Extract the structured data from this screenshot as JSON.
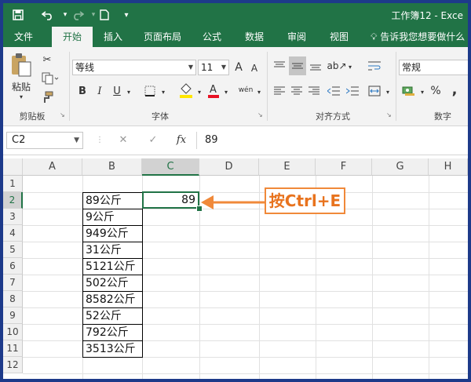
{
  "title": "工作簿12 - Exce",
  "quick_access": {
    "save_icon": "save-icon",
    "undo_icon": "undo-icon",
    "redo_icon": "redo-icon",
    "new_icon": "new-doc-icon",
    "customize_icon": "customize-icon"
  },
  "tabs": [
    {
      "label": "文件",
      "active": false
    },
    {
      "label": "开始",
      "active": true
    },
    {
      "label": "插入",
      "active": false
    },
    {
      "label": "页面布局",
      "active": false
    },
    {
      "label": "公式",
      "active": false
    },
    {
      "label": "数据",
      "active": false
    },
    {
      "label": "审阅",
      "active": false
    },
    {
      "label": "视图",
      "active": false
    }
  ],
  "tell_me": "告诉我您想要做什么",
  "ribbon": {
    "clipboard": {
      "label": "剪贴板",
      "paste_label": "粘贴"
    },
    "font": {
      "label": "字体",
      "font_name": "等线",
      "font_size": "11",
      "bold": "B",
      "italic": "I",
      "underline": "U",
      "grow": "A",
      "shrink": "A",
      "phonetic": "wén"
    },
    "alignment": {
      "label": "对齐方式"
    },
    "number": {
      "label": "数字",
      "format": "常规",
      "percent": "%",
      "comma": ","
    }
  },
  "formula_bar": {
    "name_box": "C2",
    "cancel": "✕",
    "enter": "✓",
    "fx": "fx",
    "value": "89"
  },
  "columns": [
    "A",
    "B",
    "C",
    "D",
    "E",
    "F",
    "G",
    "H"
  ],
  "selected_column": "C",
  "rows": [
    "1",
    "2",
    "3",
    "4",
    "5",
    "6",
    "7",
    "8",
    "9",
    "10",
    "11",
    "12"
  ],
  "selected_row": "2",
  "column_b": [
    "89公斤",
    "9公斤",
    "949公斤",
    "31公斤",
    "5121公斤",
    "502公斤",
    "8582公斤",
    "52公斤",
    "792公斤",
    "3513公斤"
  ],
  "active_cell_value": "89",
  "annotation": {
    "text": "按Ctrl+E",
    "color": "#f0893a"
  },
  "colors": {
    "accent": "#217346",
    "frame": "#1d3a8a"
  }
}
